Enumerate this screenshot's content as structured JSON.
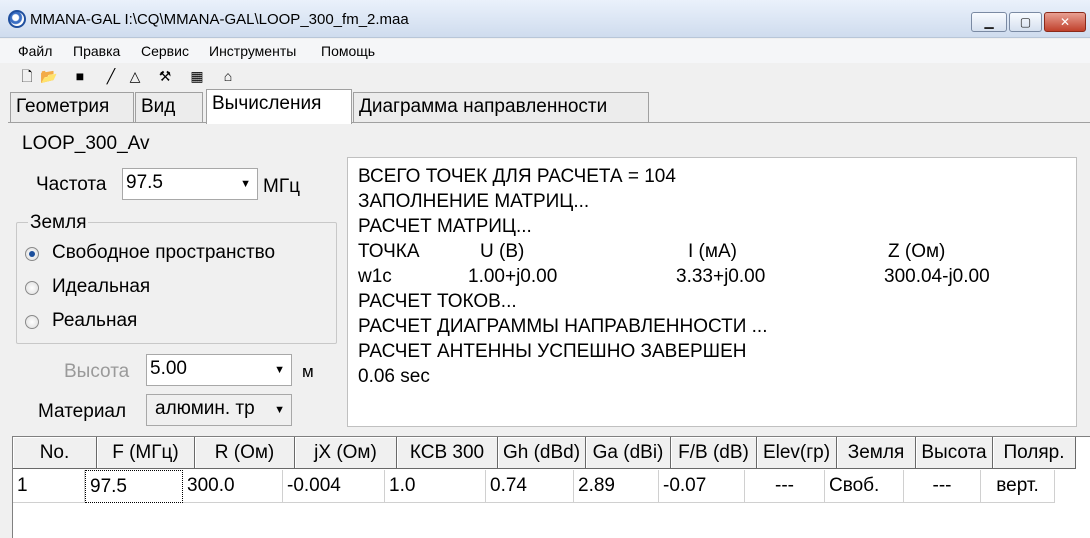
{
  "window": {
    "title": "MMANA-GAL I:\\CQ\\MMANA-GAL\\LOOP_300_fm_2.maa"
  },
  "menu": [
    "Файл",
    "Правка",
    "Сервис",
    "Инструменты",
    "Помощь"
  ],
  "toolbar_icons": [
    "new-file-icon",
    "open-folder-icon",
    "save-icon",
    "line-icon",
    "triangle-icon",
    "tools-icon",
    "calculator-icon",
    "antenna-icon"
  ],
  "tabs": [
    {
      "label": "Геометрия",
      "active": false
    },
    {
      "label": "Вид",
      "active": false
    },
    {
      "label": "Вычисления",
      "active": true
    },
    {
      "label": "Диаграмма направленности",
      "active": false
    }
  ],
  "antenna_name": "LOOP_300_Av",
  "frequency": {
    "label": "Частота",
    "value": "97.5",
    "unit": "МГц"
  },
  "ground": {
    "legend": "Земля",
    "options": [
      {
        "label": "Свободное пространство",
        "selected": true
      },
      {
        "label": "Идеальная",
        "selected": false
      },
      {
        "label": "Реальная",
        "selected": false
      }
    ]
  },
  "height": {
    "label": "Высота",
    "value": "5.00",
    "unit": "м",
    "enabled": false
  },
  "material": {
    "label": "Материал",
    "value": "алюмин. тр"
  },
  "log": {
    "lines_top": [
      "ВСЕГО ТОЧЕК ДЛЯ РАСЧЕТА = 104",
      "ЗАПОЛНЕНИЕ МАТРИЦ...",
      "РАСЧЕТ МАТРИЦ..."
    ],
    "header": {
      "point": "ТОЧКА",
      "u": "U (В)",
      "i": "I (мА)",
      "z": "Z (Ом)"
    },
    "row": {
      "point": "w1c",
      "u": "1.00+j0.00",
      "i": "3.33+j0.00",
      "z": "300.04-j0.00"
    },
    "lines_bottom": [
      "РАСЧЕТ ТОКОВ...",
      "РАСЧЕТ ДИАГРАММЫ НАПРАВЛЕННОСТИ ...",
      "РАСЧЕТ АНТЕННЫ УСПЕШНО ЗАВЕРШЕН",
      "0.06 sec"
    ]
  },
  "results": {
    "columns": [
      "No.",
      "F (МГц)",
      "R (Ом)",
      "jX (Ом)",
      "КСВ 300",
      "Gh (dBd)",
      "Ga (dBi)",
      "F/B (dB)",
      "Elev(гр)",
      "Земля",
      "Высота",
      "Поляр."
    ],
    "rows": [
      [
        "1",
        "97.5",
        "300.0",
        "-0.004",
        "1.0",
        "0.74",
        "2.89",
        "-0.07",
        "---",
        "Своб.",
        "---",
        "верт."
      ]
    ]
  }
}
